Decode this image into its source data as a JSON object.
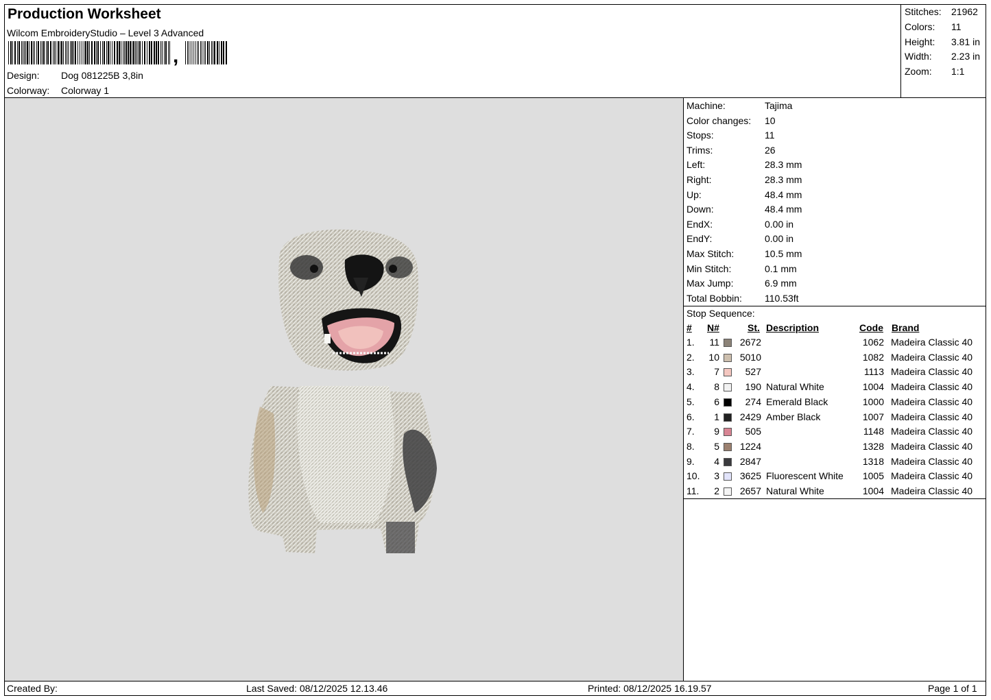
{
  "header": {
    "title": "Production Worksheet",
    "subtitle": "Wilcom EmbroideryStudio – Level 3 Advanced",
    "barcode_comma": ",",
    "design_label": "Design:",
    "design_value": "Dog 081225B 3,8in",
    "colorway_label": "Colorway:",
    "colorway_value": "Colorway 1"
  },
  "stats": [
    {
      "label": "Stitches:",
      "value": "21962"
    },
    {
      "label": "Colors:",
      "value": "11"
    },
    {
      "label": "Height:",
      "value": "3.81 in"
    },
    {
      "label": "Width:",
      "value": "2.23 in"
    },
    {
      "label": "Zoom:",
      "value": "1:1"
    }
  ],
  "machine_info": [
    {
      "label": "Machine:",
      "value": "Tajima"
    },
    {
      "label": "Color changes:",
      "value": "10"
    },
    {
      "label": "Stops:",
      "value": "11"
    },
    {
      "label": "Trims:",
      "value": "26"
    },
    {
      "label": "Left:",
      "value": "28.3 mm"
    },
    {
      "label": "Right:",
      "value": "28.3 mm"
    },
    {
      "label": "Up:",
      "value": "48.4 mm"
    },
    {
      "label": "Down:",
      "value": "48.4 mm"
    },
    {
      "label": "EndX:",
      "value": "0.00 in"
    },
    {
      "label": "EndY:",
      "value": "0.00 in"
    },
    {
      "label": "Max Stitch:",
      "value": "10.5 mm"
    },
    {
      "label": "Min Stitch:",
      "value": "0.1 mm"
    },
    {
      "label": "Max Jump:",
      "value": "6.9 mm"
    },
    {
      "label": "Total Bobbin:",
      "value": "110.53ft"
    }
  ],
  "stop_sequence": {
    "title": "Stop Sequence:",
    "headers": {
      "idx": "#",
      "n": "N#",
      "st": "St.",
      "desc": "Description",
      "code": "Code",
      "brand": "Brand"
    },
    "rows": [
      {
        "idx": "1.",
        "n": "11",
        "color": "#8c8378",
        "st": "2672",
        "desc": "",
        "code": "1062",
        "brand": "Madeira Classic 40"
      },
      {
        "idx": "2.",
        "n": "10",
        "color": "#cdbfae",
        "st": "5010",
        "desc": "",
        "code": "1082",
        "brand": "Madeira Classic 40"
      },
      {
        "idx": "3.",
        "n": "7",
        "color": "#f4c7c0",
        "st": "527",
        "desc": "",
        "code": "1113",
        "brand": "Madeira Classic 40"
      },
      {
        "idx": "4.",
        "n": "8",
        "color": "#f2f2f2",
        "st": "190",
        "desc": "Natural White",
        "code": "1004",
        "brand": "Madeira Classic 40"
      },
      {
        "idx": "5.",
        "n": "6",
        "color": "#000000",
        "st": "274",
        "desc": "Emerald Black",
        "code": "1000",
        "brand": "Madeira Classic 40"
      },
      {
        "idx": "6.",
        "n": "1",
        "color": "#222222",
        "st": "2429",
        "desc": "Amber Black",
        "code": "1007",
        "brand": "Madeira Classic 40"
      },
      {
        "idx": "7.",
        "n": "9",
        "color": "#d88594",
        "st": "505",
        "desc": "",
        "code": "1148",
        "brand": "Madeira Classic 40"
      },
      {
        "idx": "8.",
        "n": "5",
        "color": "#9c8170",
        "st": "1224",
        "desc": "",
        "code": "1328",
        "brand": "Madeira Classic 40"
      },
      {
        "idx": "9.",
        "n": "4",
        "color": "#3a3a3e",
        "st": "2847",
        "desc": "",
        "code": "1318",
        "brand": "Madeira Classic 40"
      },
      {
        "idx": "10.",
        "n": "3",
        "color": "#e2e4fb",
        "st": "3625",
        "desc": "Fluorescent White",
        "code": "1005",
        "brand": "Madeira Classic 40"
      },
      {
        "idx": "11.",
        "n": "2",
        "color": "#f4f4f4",
        "st": "2657",
        "desc": "Natural White",
        "code": "1004",
        "brand": "Madeira Classic 40"
      }
    ]
  },
  "footer": {
    "created_by": "Created By:",
    "last_saved": "Last Saved: 08/12/2025 12.13.46",
    "printed": "Printed: 08/12/2025 16.19.57",
    "page": "Page 1 of 1"
  },
  "colors": {
    "preview_bg": "#dedede",
    "border": "#000000"
  }
}
